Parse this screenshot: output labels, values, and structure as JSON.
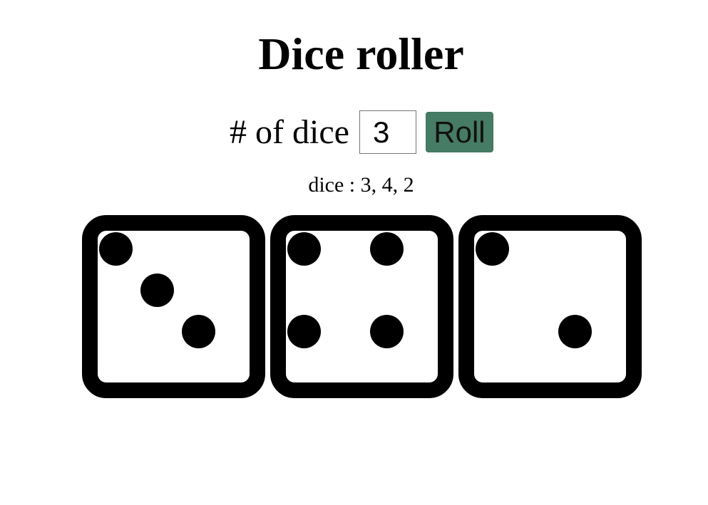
{
  "app": {
    "title": "Dice roller"
  },
  "controls": {
    "count_label": "# of dice",
    "count_value": "3",
    "roll_label": "Roll"
  },
  "results": {
    "text": "dice : 3, 4, 2"
  },
  "dice": [
    {
      "value": 3,
      "icon": "die-face-3-icon"
    },
    {
      "value": 4,
      "icon": "die-face-4-icon"
    },
    {
      "value": 2,
      "icon": "die-face-2-icon"
    }
  ],
  "colors": {
    "roll_button": "#467b65",
    "die": "#000000",
    "background": "#ffffff"
  }
}
